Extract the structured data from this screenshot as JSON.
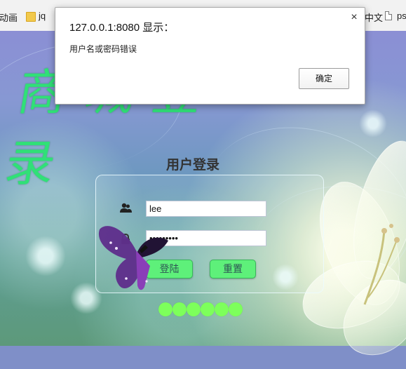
{
  "bookmarks": [
    {
      "label": "动画",
      "icon": "none"
    },
    {
      "label": "jq",
      "icon": "folder-icon"
    },
    {
      "label": "中文",
      "icon": "none"
    },
    {
      "label": "ps",
      "icon": "page-icon"
    }
  ],
  "dialog": {
    "title": "127.0.0.1:8080 显示：",
    "message": "用户名或密码错误",
    "ok_label": "确定",
    "close_symbol": "×"
  },
  "page": {
    "calligraphy_text": "商城登录",
    "login_title": "用户登录",
    "username_value": "lee",
    "password_value": "•••••••••",
    "login_button": "登陆",
    "reset_button": "重置",
    "accent_green": "#5ef07a",
    "dot_color": "#7dff5b",
    "dots_count_label": "6"
  }
}
